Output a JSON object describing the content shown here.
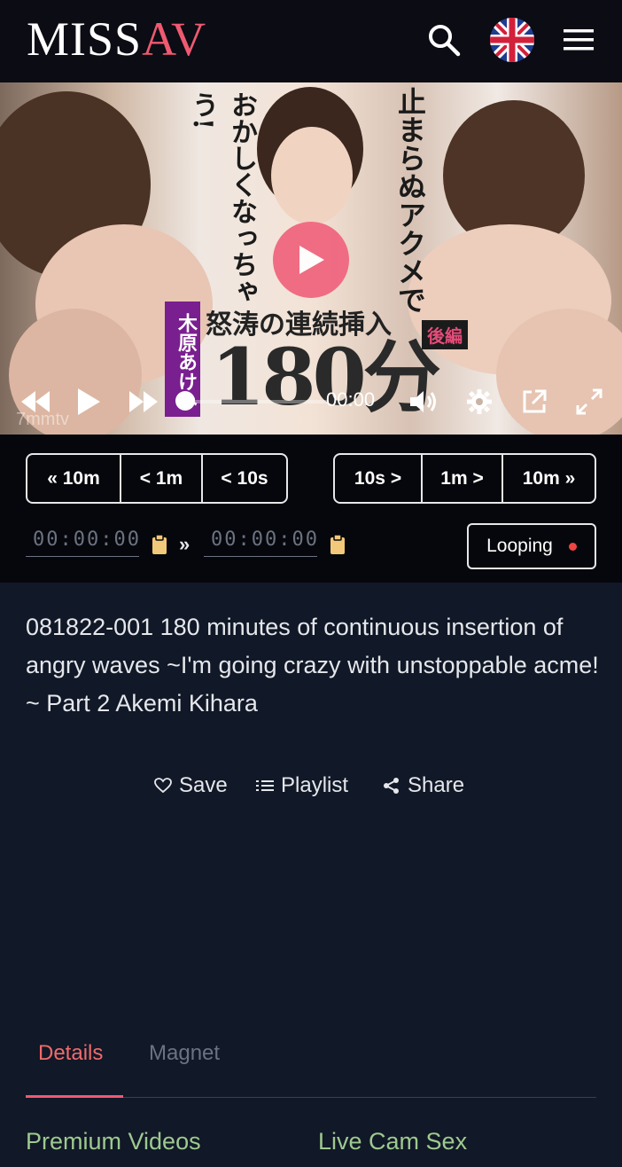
{
  "header": {
    "logo_white": "MISS",
    "logo_pink": "AV",
    "search_icon": "search-icon",
    "language_icon": "uk-flag-icon",
    "menu_icon": "hamburger-menu-icon"
  },
  "player": {
    "thumbnail_text_left": "おかしくなっちゃう!",
    "thumbnail_text_right": "止まらぬアクメで",
    "thumbnail_title": "怒涛の連続挿入",
    "thumbnail_number": "180分",
    "thumbnail_tag": "後編",
    "thumbnail_name": "木原あけみ",
    "watermark": "7mmtv",
    "time": "00:00",
    "progress": 0,
    "controls": [
      "rewind-icon",
      "play-icon",
      "fast-forward-icon",
      "volume-icon",
      "settings-icon",
      "popout-icon",
      "fullscreen-icon"
    ]
  },
  "seek_back": [
    "10m",
    "1m",
    "10s"
  ],
  "seek_forward": [
    "10s",
    "1m",
    "10m"
  ],
  "loop_range": {
    "start_placeholder": "00:00:00",
    "end_placeholder": "00:00:00",
    "separator": "»",
    "looping_label": "Looping"
  },
  "video": {
    "title": "081822-001 180 minutes of continuous insertion of angry waves ~I'm going crazy with unstoppable acme! ~ Part 2 Akemi Kihara"
  },
  "actions": {
    "save": "Save",
    "playlist": "Playlist",
    "share": "Share"
  },
  "tabs": {
    "details": "Details",
    "magnet": "Magnet",
    "active": "Details"
  },
  "footer_links": {
    "premium": "Premium Videos",
    "livecam": "Live Cam Sex"
  },
  "colors": {
    "brand_pink": "#ef5a71",
    "background": "#111827",
    "toolbar": "#06070c",
    "link_green": "#9ec98f"
  }
}
